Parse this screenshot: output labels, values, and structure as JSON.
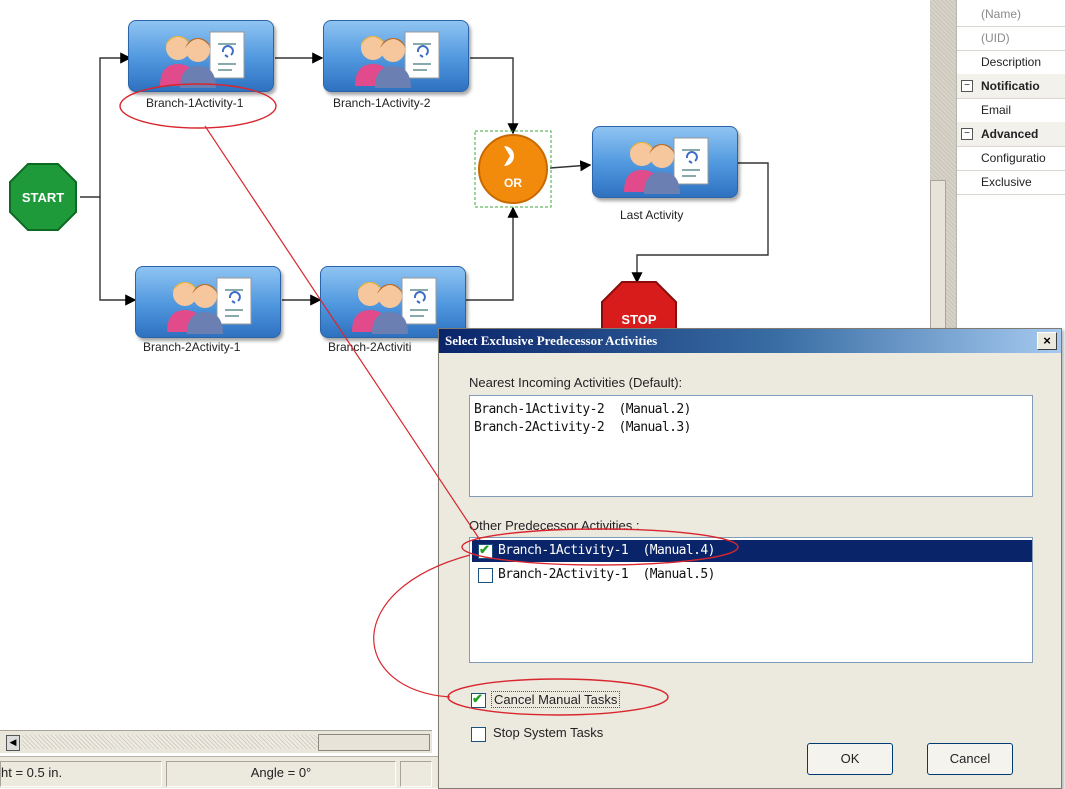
{
  "diagram": {
    "start": "START",
    "stop": "STOP",
    "or": "OR",
    "activities": {
      "b1a1": "Branch-1Activity-1",
      "b1a2": "Branch-1Activity-2",
      "b2a1": "Branch-2Activity-1",
      "b2a2": "Branch-2Activiti",
      "last": "Last Activity"
    }
  },
  "properties": {
    "rows": {
      "name": "(Name)",
      "uid": "(UID)",
      "description": "Description",
      "notification": "Notificatio",
      "email": "Email",
      "advanced": "Advanced",
      "configuration": "Configuratio",
      "exclusive": "Exclusive"
    }
  },
  "status": {
    "height": "ht = 0.5 in.",
    "angle": "Angle = 0°"
  },
  "dialog": {
    "title": "Select Exclusive Predecessor Activities",
    "close": "×",
    "nearest_label": "Nearest Incoming Activities  (Default):",
    "nearest": {
      "line1": "Branch-1Activity-2  (Manual.2)",
      "line2": "Branch-2Activity-2  (Manual.3)"
    },
    "other_label": "Other Predecessor Activities :",
    "other": {
      "row1": "Branch-1Activity-1  (Manual.4)",
      "row2": "Branch-2Activity-1  (Manual.5)"
    },
    "cancel_manual": "Cancel Manual Tasks",
    "stop_system": "Stop System Tasks",
    "ok": "OK",
    "cancel": "Cancel"
  }
}
